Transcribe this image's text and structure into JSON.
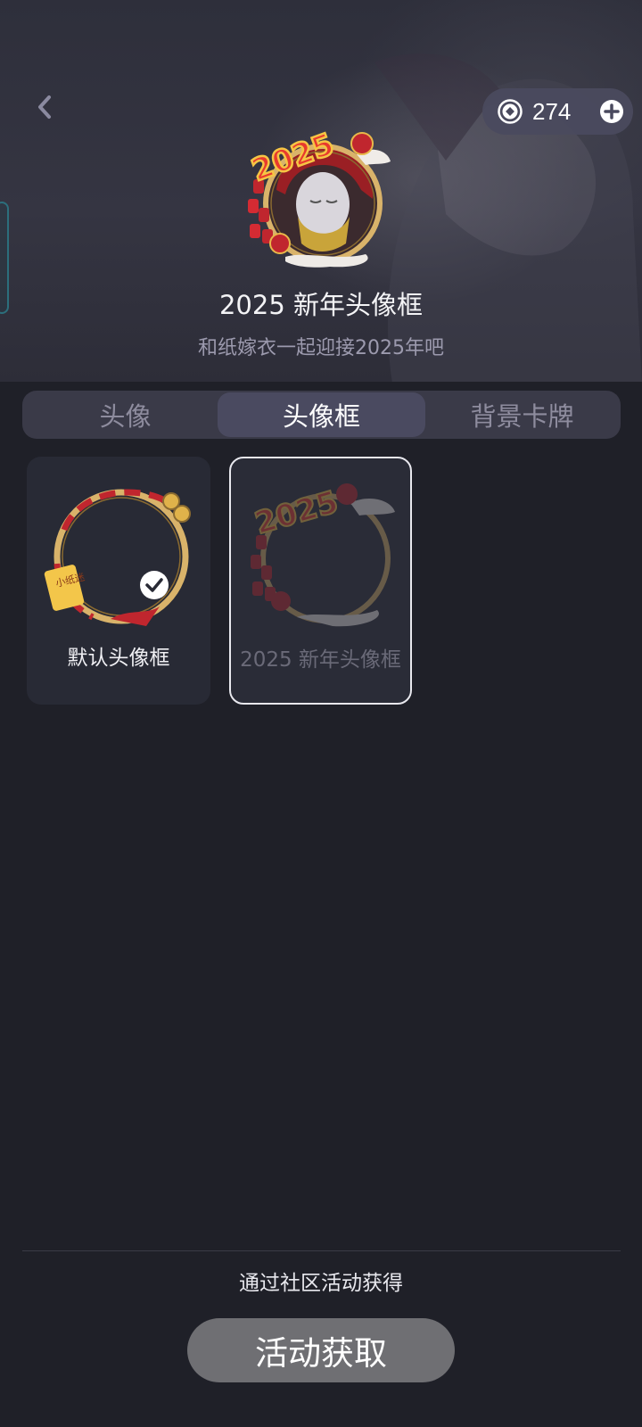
{
  "header": {
    "back_icon": "chevron-left-icon",
    "coins": {
      "icon": "coin-icon",
      "value": "274",
      "add_icon": "plus-circle-icon"
    }
  },
  "preview": {
    "frame_year": "2025",
    "title": "2025 新年头像框",
    "subtitle": "和纸嫁衣一起迎接2025年吧"
  },
  "tabs": [
    {
      "label": "头像",
      "selected": false
    },
    {
      "label": "头像框",
      "selected": true
    },
    {
      "label": "背景卡牌",
      "selected": false
    }
  ],
  "frames": [
    {
      "label": "默认头像框",
      "tag_text": "小纸迷",
      "equipped": true
    },
    {
      "label": "2025 新年头像框",
      "year_text": "2025",
      "selected": true,
      "owned": false
    }
  ],
  "footer": {
    "hint": "通过社区活动获得",
    "cta_label": "活动获取"
  },
  "colors": {
    "background": "#1f2028",
    "tab_active": "#4a4a60",
    "cta": "#6f6f73",
    "gold": "#d9b36a",
    "red": "#c0262e"
  }
}
